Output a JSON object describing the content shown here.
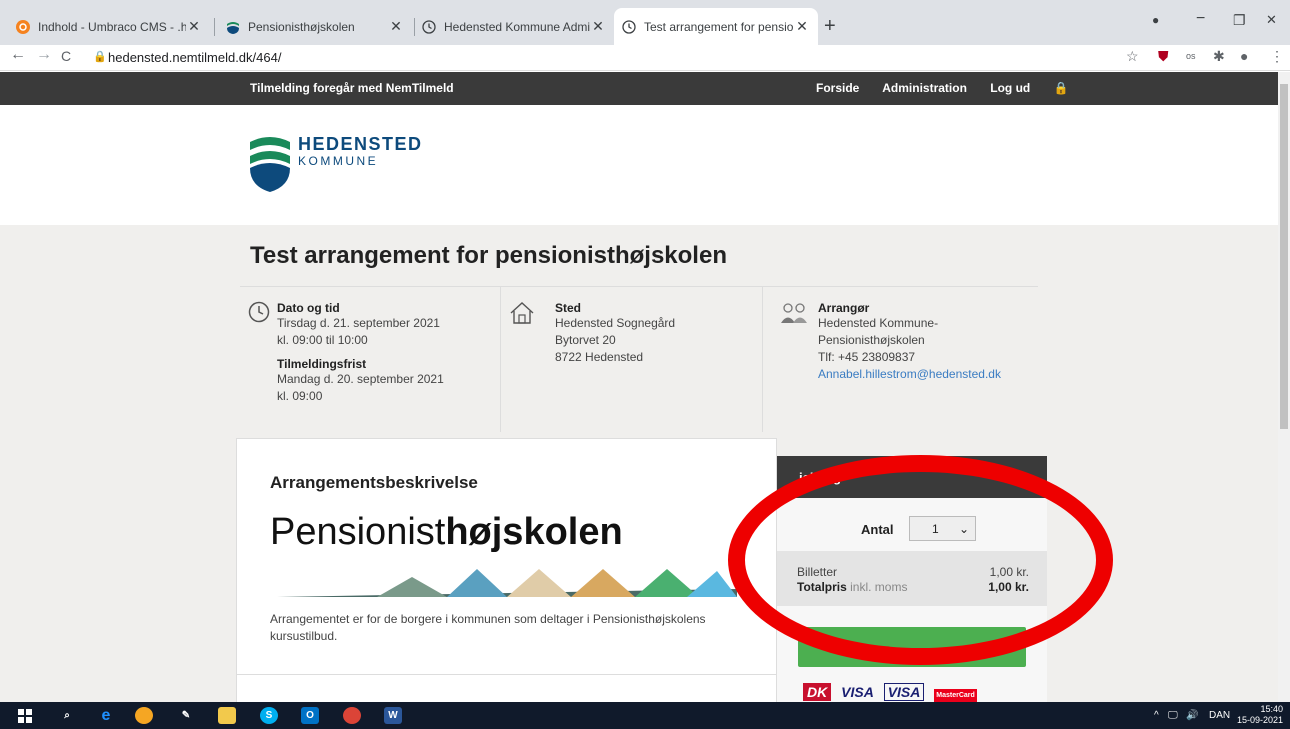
{
  "browser": {
    "tabs": [
      {
        "title": "Indhold - Umbraco CMS - .heden",
        "active": false
      },
      {
        "title": "Pensionisthøjskolen",
        "active": false
      },
      {
        "title": "Hedensted Kommune Administra",
        "active": false
      },
      {
        "title": "Test arrangement for pensionisth",
        "active": true
      }
    ],
    "new_tab": "+",
    "url": "hedensted.nemtilmeld.dk/464/",
    "window": {
      "minimize": "−",
      "maximize": "❐",
      "close": "✕"
    }
  },
  "topnav": {
    "left_text": "Tilmelding foregår med NemTilmeld",
    "links": [
      "Forside",
      "Administration",
      "Log ud"
    ]
  },
  "logo": {
    "line1": "HEDENSTED",
    "line2": "KOMMUNE"
  },
  "event": {
    "title": "Test arrangement for pensionisthøjskolen",
    "datetime": {
      "heading": "Dato og tid",
      "line1": "Tirsdag d. 21. september 2021",
      "line2": "kl. 09:00 til 10:00",
      "deadline_heading": "Tilmeldingsfrist",
      "deadline_line1": "Mandag d. 20. september 2021",
      "deadline_line2": "kl. 09:00"
    },
    "place": {
      "heading": "Sted",
      "line1": "Hedensted Sognegård",
      "line2": "Bytorvet 20",
      "line3": "8722 Hedensted"
    },
    "organizer": {
      "heading": "Arrangør",
      "line1": "Hedensted Kommune-",
      "line2": "Pensionisthøjskolen",
      "line3": "Tlf: +45 23809837",
      "email": "Annabel.hillestrom@hedensted.dk"
    }
  },
  "description": {
    "heading": "Arrangementsbeskrivelse",
    "logo_regular": "Pensionist",
    "logo_bold": "højskolen",
    "text": "Arrangementet er for de borgere i kommunen som deltager i Pensionisthøjskolens kursustilbud."
  },
  "signup": {
    "heading": "ielding",
    "antal_label": "Antal",
    "antal_value": "1",
    "tickets_label": "Billetter",
    "tickets_value": "1,00 kr.",
    "total_label": "Totalpris",
    "total_suffix": "inkl. moms",
    "total_value": "1,00 kr.",
    "cards": [
      "DK",
      "VISA",
      "VISA",
      "MasterCard"
    ]
  },
  "taskbar": {
    "lang": "DAN",
    "time": "15:40",
    "date": "15-09-2021"
  },
  "colors": {
    "accent_red": "#ee0000",
    "dark_nav": "#3a3a3a",
    "green_button": "#4caf50",
    "link": "#3a7cc2"
  }
}
